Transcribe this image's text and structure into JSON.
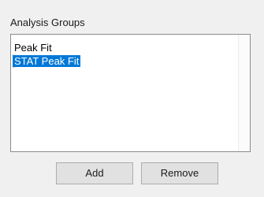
{
  "panel": {
    "title": "Analysis Groups"
  },
  "list": {
    "items": [
      {
        "label": "Peak Fit",
        "selected": false
      },
      {
        "label": "STAT Peak Fit",
        "selected": true
      }
    ]
  },
  "buttons": {
    "add_label": "Add",
    "remove_label": "Remove"
  },
  "colors": {
    "selection": "#0078d7",
    "button_face": "#e1e1e1",
    "window_bg": "#f0f0f0"
  }
}
